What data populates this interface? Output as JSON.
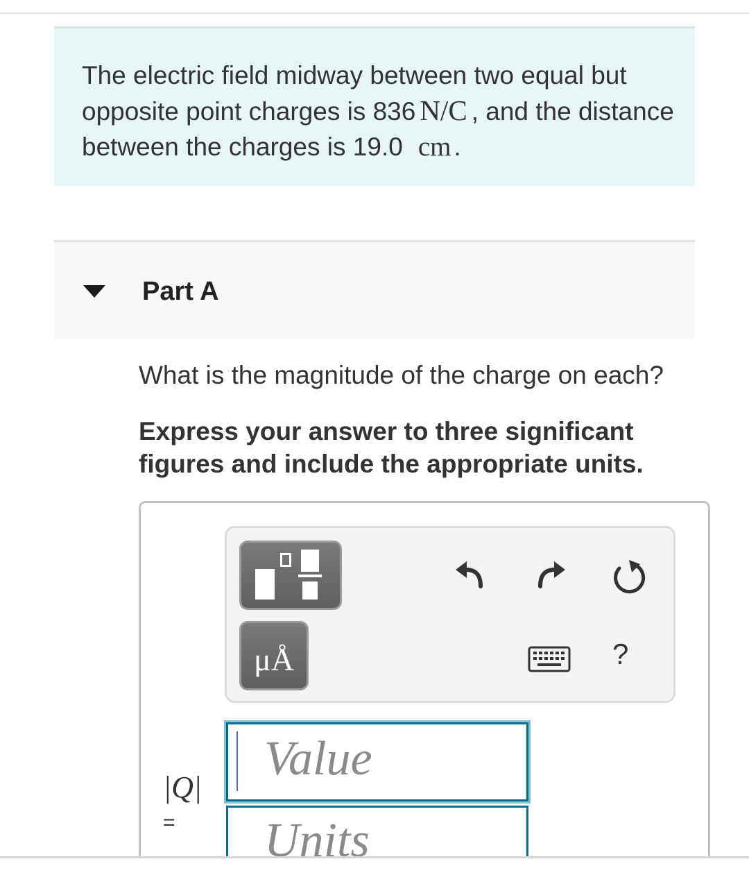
{
  "problem": {
    "text_1": "The electric field midway between two equal but opposite point charges is 836",
    "field_units": "N/C",
    "text_2": ", and the distance between the charges is 19.0",
    "distance_units": "cm",
    "text_3": "."
  },
  "part": {
    "title": "Part A",
    "question": "What is the magnitude of the charge on each?",
    "instruction": "Express your answer to three significant figures and include the appropriate units."
  },
  "toolbar": {
    "templates_icon": "fraction-templates-icon",
    "units_label": "μÅ",
    "undo_icon": "undo-icon",
    "redo_icon": "redo-icon",
    "reset_icon": "reset-icon",
    "keyboard_icon": "keyboard-icon",
    "help_label": "?"
  },
  "answer": {
    "variable_label": "|Q|",
    "equals": "=",
    "value_placeholder": "Value",
    "units_placeholder": "Units"
  },
  "colors": {
    "intro_bg": "#e6f5f5",
    "input_border": "#0a6c8b",
    "button_gray": "#6b6b6b"
  }
}
